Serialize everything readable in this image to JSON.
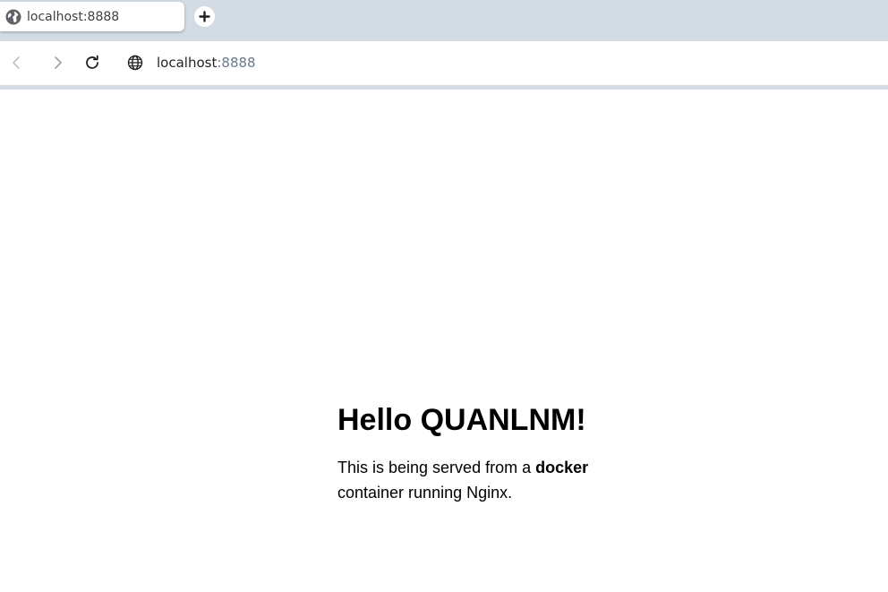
{
  "browser": {
    "tab": {
      "title": "localhost:8888",
      "favicon_icon": "globe-icon"
    },
    "new_tab_icon": "plus-icon",
    "toolbar": {
      "back_icon": "chevron-left-icon",
      "forward_icon": "chevron-right-icon",
      "reload_icon": "reload-icon",
      "site_info_icon": "globe-icon",
      "address_host": "localhost",
      "address_rest": ":8888"
    },
    "colors": {
      "tabstrip": "#d3dce4",
      "address_port": "#6b7a89"
    }
  },
  "page": {
    "heading": "Hello QUANLNM!",
    "text_before": "This is being served from a ",
    "text_bold": "docker",
    "text_after": " container running Nginx."
  }
}
